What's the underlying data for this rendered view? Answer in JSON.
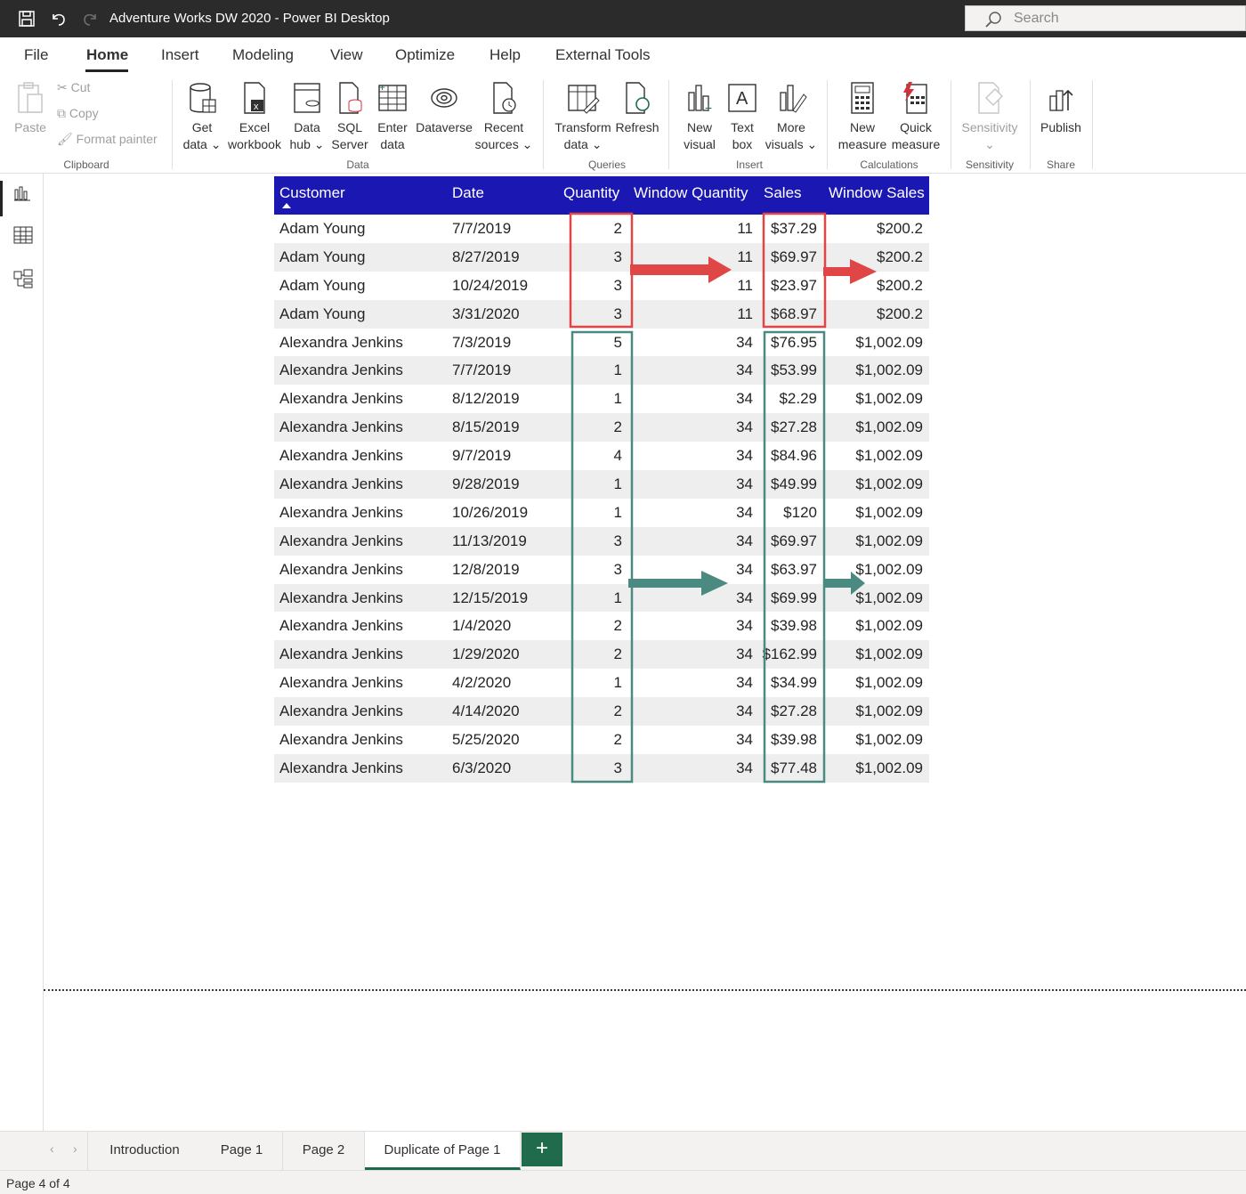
{
  "titlebar": {
    "title": "Adventure Works DW 2020 - Power BI Desktop",
    "search_placeholder": "Search"
  },
  "menu": {
    "tabs": [
      "File",
      "Home",
      "Insert",
      "Modeling",
      "View",
      "Optimize",
      "Help",
      "External Tools"
    ],
    "active": "Home"
  },
  "ribbon": {
    "clipboard": {
      "paste": "Paste",
      "cut": "Cut",
      "copy": "Copy",
      "format_painter": "Format painter",
      "label": "Clipboard"
    },
    "data": {
      "get_data": [
        "Get",
        "data"
      ],
      "excel": [
        "Excel",
        "workbook"
      ],
      "data_hub": [
        "Data",
        "hub"
      ],
      "sql": [
        "SQL",
        "Server"
      ],
      "enter": [
        "Enter",
        "data"
      ],
      "dataverse": "Dataverse",
      "recent": [
        "Recent",
        "sources"
      ],
      "label": "Data"
    },
    "queries": {
      "transform": [
        "Transform",
        "data"
      ],
      "refresh": "Refresh",
      "label": "Queries"
    },
    "insert": {
      "new_visual": [
        "New",
        "visual"
      ],
      "text_box": [
        "Text",
        "box"
      ],
      "more_visuals": [
        "More",
        "visuals"
      ],
      "label": "Insert"
    },
    "calculations": {
      "new_measure": [
        "New",
        "measure"
      ],
      "quick_measure": [
        "Quick",
        "measure"
      ],
      "label": "Calculations"
    },
    "sensitivity": {
      "button": "Sensitivity",
      "label": "Sensitivity"
    },
    "share": {
      "publish": "Publish",
      "label": "Share"
    }
  },
  "table": {
    "columns": [
      "Customer",
      "Date",
      "Quantity",
      "Window Quantity",
      "Sales",
      "Window Sales"
    ],
    "rows": [
      [
        "Adam Young",
        "7/7/2019",
        "2",
        "11",
        "$37.29",
        "$200.2"
      ],
      [
        "Adam Young",
        "8/27/2019",
        "3",
        "11",
        "$69.97",
        "$200.2"
      ],
      [
        "Adam Young",
        "10/24/2019",
        "3",
        "11",
        "$23.97",
        "$200.2"
      ],
      [
        "Adam Young",
        "3/31/2020",
        "3",
        "11",
        "$68.97",
        "$200.2"
      ],
      [
        "Alexandra Jenkins",
        "7/3/2019",
        "5",
        "34",
        "$76.95",
        "$1,002.09"
      ],
      [
        "Alexandra Jenkins",
        "7/7/2019",
        "1",
        "34",
        "$53.99",
        "$1,002.09"
      ],
      [
        "Alexandra Jenkins",
        "8/12/2019",
        "1",
        "34",
        "$2.29",
        "$1,002.09"
      ],
      [
        "Alexandra Jenkins",
        "8/15/2019",
        "2",
        "34",
        "$27.28",
        "$1,002.09"
      ],
      [
        "Alexandra Jenkins",
        "9/7/2019",
        "4",
        "34",
        "$84.96",
        "$1,002.09"
      ],
      [
        "Alexandra Jenkins",
        "9/28/2019",
        "1",
        "34",
        "$49.99",
        "$1,002.09"
      ],
      [
        "Alexandra Jenkins",
        "10/26/2019",
        "1",
        "34",
        "$120",
        "$1,002.09"
      ],
      [
        "Alexandra Jenkins",
        "11/13/2019",
        "3",
        "34",
        "$69.97",
        "$1,002.09"
      ],
      [
        "Alexandra Jenkins",
        "12/8/2019",
        "3",
        "34",
        "$63.97",
        "$1,002.09"
      ],
      [
        "Alexandra Jenkins",
        "12/15/2019",
        "1",
        "34",
        "$69.99",
        "$1,002.09"
      ],
      [
        "Alexandra Jenkins",
        "1/4/2020",
        "2",
        "34",
        "$39.98",
        "$1,002.09"
      ],
      [
        "Alexandra Jenkins",
        "1/29/2020",
        "2",
        "34",
        "$162.99",
        "$1,002.09"
      ],
      [
        "Alexandra Jenkins",
        "4/2/2020",
        "1",
        "34",
        "$34.99",
        "$1,002.09"
      ],
      [
        "Alexandra Jenkins",
        "4/14/2020",
        "2",
        "34",
        "$27.28",
        "$1,002.09"
      ],
      [
        "Alexandra Jenkins",
        "5/25/2020",
        "2",
        "34",
        "$39.98",
        "$1,002.09"
      ],
      [
        "Alexandra Jenkins",
        "6/3/2020",
        "3",
        "34",
        "$77.48",
        "$1,002.09"
      ]
    ],
    "header_color": "#1a17b2"
  },
  "annotations": {
    "red": "#e04646",
    "teal": "#4a8a80"
  },
  "page_tabs": {
    "tabs": [
      "Introduction",
      "Page 1",
      "Page 2",
      "Duplicate of Page 1"
    ],
    "active": "Duplicate of Page 1",
    "add": "+"
  },
  "status": {
    "text": "Page 4 of 4"
  }
}
